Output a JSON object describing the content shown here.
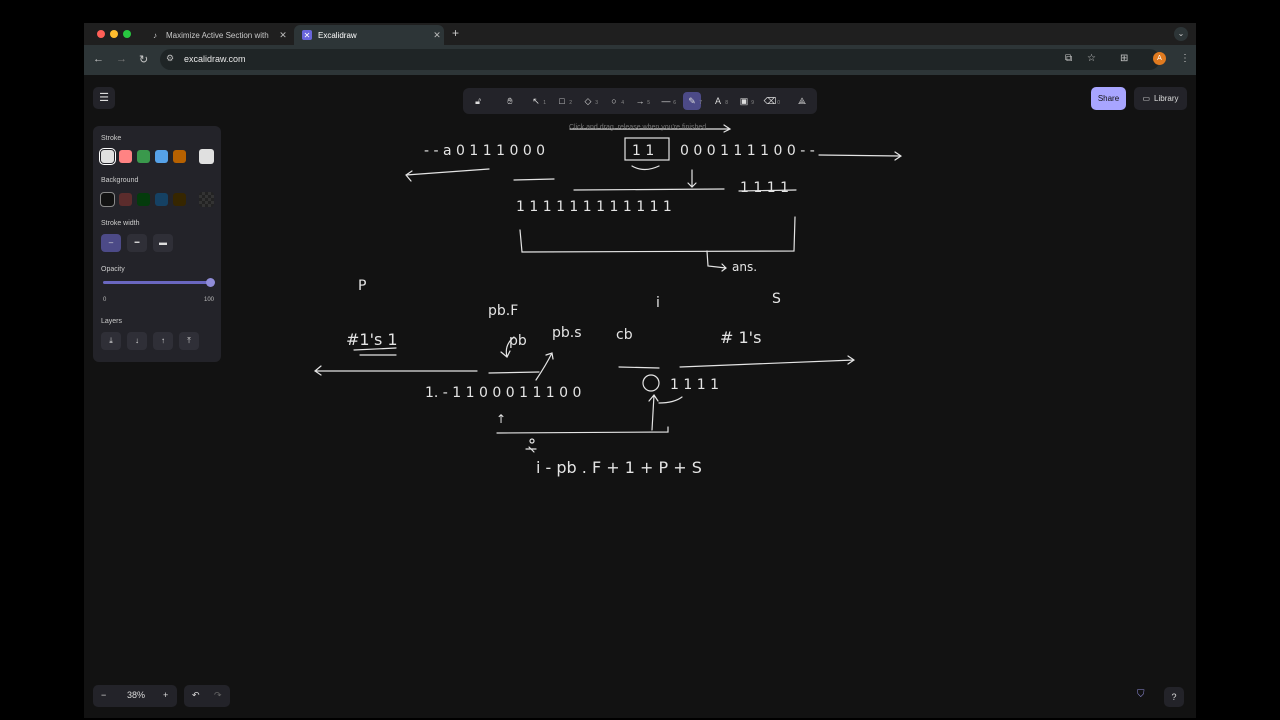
{
  "browser": {
    "tabs": [
      {
        "title": "Maximize Active Section with",
        "active": false
      },
      {
        "title": "Excalidraw",
        "active": true
      }
    ],
    "url": "excalidraw.com",
    "avatar_letter": "A",
    "traffic_colors": [
      "#ff5f57",
      "#febc2e",
      "#28c840"
    ]
  },
  "excalidraw": {
    "hint": "Click and drag, release when you're finished",
    "share_label": "Share",
    "library_label": "Library",
    "tool_shortcuts": [
      "1",
      "2",
      "3",
      "4",
      "5",
      "6",
      "7",
      "8",
      "9",
      "0"
    ],
    "properties": {
      "stroke_label": "Stroke",
      "stroke_colors": [
        "#e0e0e0",
        "#ff8383",
        "#3a994c",
        "#56a2e8",
        "#b76100"
      ],
      "stroke_current": "#e0e0e0",
      "background_label": "Background",
      "background_colors": [
        "#121212",
        "#5b2c2c",
        "#043b0c",
        "#154163",
        "#362600"
      ],
      "stroke_width_label": "Stroke width",
      "opacity_label": "Opacity",
      "opacity_min": "0",
      "opacity_max": "100",
      "opacity_value": 100,
      "layers_label": "Layers"
    },
    "zoom": "38%",
    "accent": "#a8a5ff"
  },
  "drawing": {
    "row1": "- - a 0 1 1 1 0 0 0",
    "row1_right": "0 0 0   1 1 1 1   0 0 - -",
    "row2": "1 1   1 1 1   1 1 1 1 1 1 1",
    "row2_right": "1 1 1 1",
    "ans": "ans.",
    "p": "P",
    "s": "S",
    "i": "i",
    "pb_f": "pb.F",
    "ones_left": "#1's  1",
    "pb": "pb",
    "pb_s": "pb.s",
    "cb": "cb",
    "ones_right": "# 1's",
    "row3": "1. - 1 1   0 0 0   1 1 1   0 0",
    "row3_right": "1 1 1 1",
    "formula": "i - pb . F + 1  + P + S"
  }
}
